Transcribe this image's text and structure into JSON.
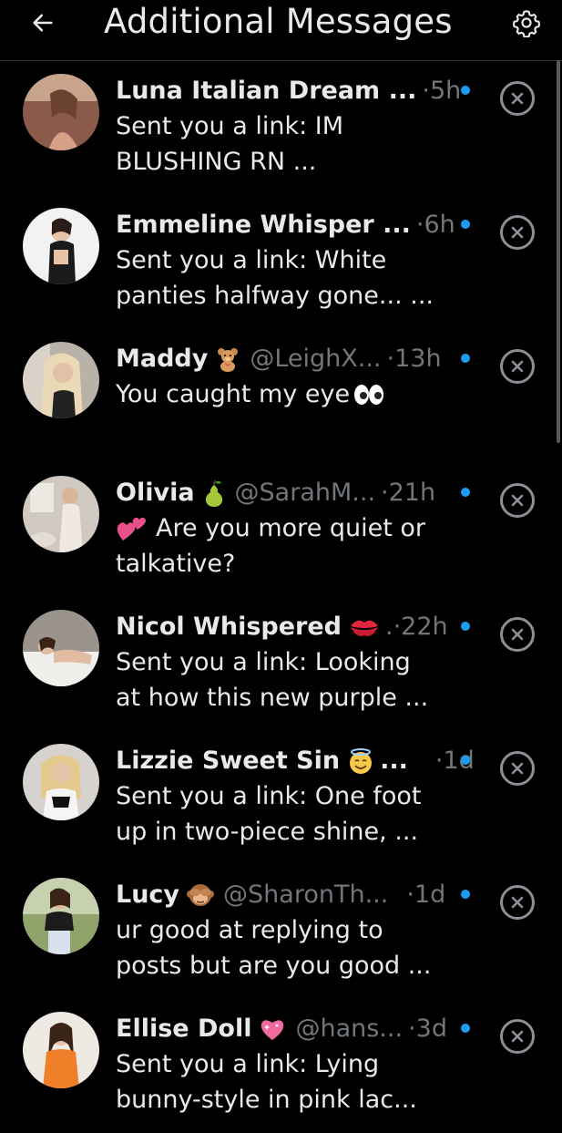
{
  "header": {
    "title": "Additional Messages",
    "back_icon": "arrow-left-icon",
    "settings_icon": "gear-icon"
  },
  "colors": {
    "background": "#000000",
    "unread_dot": "#1d9bf0",
    "muted_text": "#71767b"
  },
  "messages": [
    {
      "name": "Luna Italian Dream ...",
      "emoji": "",
      "handle": "",
      "time": "·5h",
      "lines": [
        "Sent you a link: IM",
        "BLUSHING RN ..."
      ],
      "unread": true
    },
    {
      "name": "Emmeline Whisper ...",
      "emoji": "",
      "handle": "",
      "time": "·6h",
      "lines": [
        "Sent you a link: White",
        "panties halfway gone... ..."
      ],
      "unread": true
    },
    {
      "name": "Maddy",
      "emoji": "teddy-bear-emoji",
      "handle": "@LeighX...",
      "time": "·13h",
      "lines": [
        "You caught my eye"
      ],
      "line_emoji": "eyes-emoji",
      "unread": true
    },
    {
      "name": "Olivia",
      "emoji": "pear-emoji",
      "handle": "@SarahM...",
      "time": "·21h",
      "lines": [
        "Are you more quiet or",
        "talkative?"
      ],
      "lead_emoji": "two-hearts-emoji",
      "unread": true
    },
    {
      "name": "Nicol Whispered",
      "emoji": "kiss-lips-emoji",
      "handle": "",
      "time": ".·22h",
      "lines": [
        "Sent you a link: Looking",
        "at how this new purple ..."
      ],
      "unread": true
    },
    {
      "name": "Lizzie Sweet Sin",
      "emoji": "halo-smile-emoji",
      "handle": "...",
      "time": "·1d",
      "lines": [
        "Sent you a link: One foot",
        "up in two-piece shine, ..."
      ],
      "unread": true
    },
    {
      "name": "Lucy",
      "emoji": "see-no-evil-monkey-emoji",
      "handle": "@SharonTh...",
      "time": "·1d",
      "lines": [
        "ur good at replying to",
        "posts but are you good ..."
      ],
      "unread": true
    },
    {
      "name": "Ellise Doll",
      "emoji": "sparkling-heart-emoji",
      "handle": "@hans...",
      "time": "·3d",
      "lines": [
        "Sent you a link: Lying",
        "bunny-style in pink lac..."
      ],
      "unread": true
    }
  ]
}
